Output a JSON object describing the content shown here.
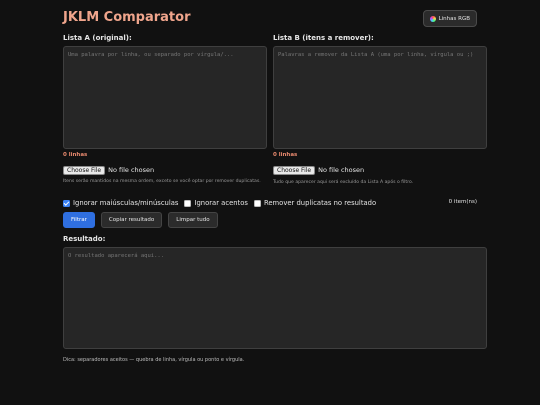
{
  "app": {
    "title": "JKLM Comparator",
    "rgb_button_label": "Linhas RGB",
    "accent_color": "#f0a58c"
  },
  "list_a": {
    "label": "Lista A (original):",
    "placeholder": "Uma palavra por linha, ou separado por vírgula/...",
    "value": "",
    "count_text": "0 linhas",
    "file_button": "Choose File",
    "file_status": "No file chosen",
    "hint": "Itens serão mantidos na mesma ordem, exceto se você optar por remover duplicatas."
  },
  "list_b": {
    "label": "Lista B (itens a remover):",
    "placeholder": "Palavras a remover da Lista A (uma por linha, vírgula ou ;)",
    "value": "",
    "count_text": "0 linhas",
    "file_button": "Choose File",
    "file_status": "No file chosen",
    "hint": "Tudo que aparecer aqui será excluído da Lista A após o filtro."
  },
  "options": {
    "ignore_case": {
      "label": "Ignorar maiúsculas/minúsculas",
      "checked": true
    },
    "ignore_accents": {
      "label": "Ignorar acentos",
      "checked": false
    },
    "remove_duplicates": {
      "label": "Remover duplicatas no resultado",
      "checked": false
    },
    "item_count": "0 item(ns)"
  },
  "actions": {
    "filter": "Filtrar",
    "copy": "Copiar resultado",
    "clear": "Limpar tudo"
  },
  "result": {
    "label": "Resultado:",
    "placeholder": "O resultado aparecerá aqui...",
    "value": ""
  },
  "footer": {
    "tip": "Dica: separadores aceitos — quebra de linha, vírgula ou ponto e vírgula."
  }
}
